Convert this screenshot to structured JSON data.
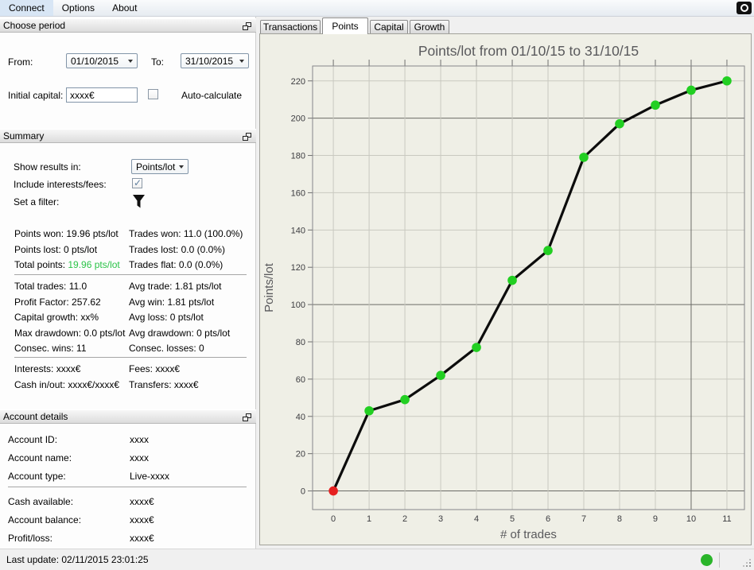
{
  "menu": {
    "items": [
      "Connect",
      "Options",
      "About"
    ]
  },
  "choose_period": {
    "title": "Choose period",
    "from_label": "From:",
    "from_value": "01/10/2015",
    "to_label": "To:",
    "to_value": "31/10/2015",
    "initial_capital_label": "Initial capital:",
    "initial_capital_value": "xxxx€",
    "auto_calculate_label": "Auto-calculate"
  },
  "summary": {
    "title": "Summary",
    "show_results_label": "Show results in:",
    "show_results_value": "Points/lot",
    "include_label": "Include interests/fees:",
    "include_checked": true,
    "filter_label": "Set a filter:",
    "group1": [
      {
        "left": "Points won: 19.96 pts/lot",
        "right": "Trades won: 11.0 (100.0%)"
      },
      {
        "left": "Points lost: 0 pts/lot",
        "right": "Trades lost: 0.0 (0.0%)"
      },
      {
        "left_prefix": "Total points: ",
        "left_value": "19.96 pts/lot",
        "right": "Trades flat: 0.0 (0.0%)"
      }
    ],
    "group2": [
      {
        "left": "Total trades: 11.0",
        "right": "Avg trade: 1.81 pts/lot"
      },
      {
        "left": "Profit Factor: 257.62",
        "right": "Avg win: 1.81 pts/lot"
      },
      {
        "left": "Capital growth: xx%",
        "right": "Avg loss: 0 pts/lot"
      },
      {
        "left": "Max drawdown: 0.0 pts/lot",
        "right": "Avg drawdown: 0 pts/lot"
      },
      {
        "left": "Consec. wins: 11",
        "right": "Consec. losses: 0"
      }
    ],
    "group3": [
      {
        "left": "Interests: xxxx€",
        "right": "Fees: xxxx€"
      },
      {
        "left": "Cash in/out: xxxx€/xxxx€",
        "right": "Transfers: xxxx€"
      }
    ],
    "total_points_color": "#2bc348"
  },
  "account": {
    "title": "Account details",
    "rows": [
      {
        "label": "Account ID:",
        "value": "xxxx"
      },
      {
        "label": "Account name:",
        "value": "xxxx"
      },
      {
        "label": "Account type:",
        "value": "Live-xxxx"
      }
    ],
    "rows2": [
      {
        "label": "Cash available:",
        "value": "xxxx€"
      },
      {
        "label": "Account balance:",
        "value": "xxxx€"
      },
      {
        "label": "Profit/loss:",
        "value": "xxxx€"
      }
    ]
  },
  "tabs": {
    "items": [
      "Transactions",
      "Points",
      "Capital",
      "Growth"
    ],
    "active": "Points"
  },
  "chart_data": {
    "type": "line",
    "title": "Points/lot from 01/10/15 to 31/10/15",
    "xlabel": "# of trades",
    "ylabel": "Points/lot",
    "x": [
      0,
      1,
      2,
      3,
      4,
      5,
      6,
      7,
      8,
      9,
      10,
      11
    ],
    "values": [
      0,
      43,
      49,
      62,
      77,
      113,
      129,
      179,
      197,
      207,
      215,
      220
    ],
    "xlim": [
      -0.58,
      11.49
    ],
    "ylim": [
      -10,
      228
    ],
    "x_ticks": [
      0,
      1,
      2,
      3,
      4,
      5,
      6,
      7,
      8,
      9,
      10,
      11
    ],
    "y_ticks": [
      0,
      20,
      40,
      60,
      80,
      100,
      120,
      140,
      160,
      180,
      200,
      220
    ],
    "grid": true,
    "x_major_every": 10,
    "y_major_every": 100,
    "line_color": "#0c0c0c",
    "point_color": "#22cf22",
    "first_point_color": "#e62020",
    "bg_color": "#efefe6",
    "minor_grid_color": "#c9c9c0",
    "major_grid_color": "#6b6b66",
    "border_color": "#85858a",
    "label_color": "#59595c",
    "tick_label_color": "#3c3c40"
  },
  "status_bar": {
    "last_update": "Last update: 02/11/2015 23:01:25",
    "connection_color": "#2ab52a"
  }
}
